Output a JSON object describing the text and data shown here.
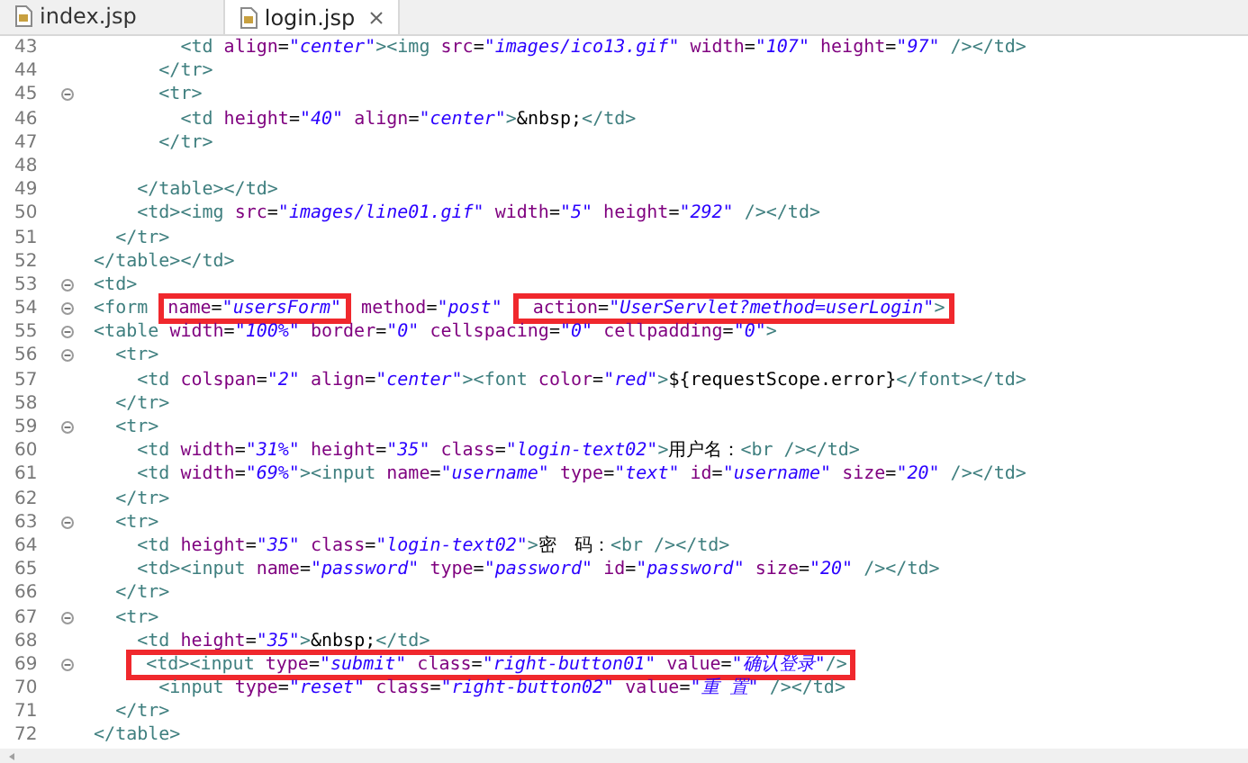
{
  "tabs": [
    {
      "label": "index.jsp",
      "selected": false,
      "closable": false
    },
    {
      "label": "login.jsp",
      "selected": true,
      "closable": true
    }
  ],
  "lines": [
    {
      "number": "43",
      "foldable": false,
      "tokens": [
        {
          "kind": "tag",
          "text": "          <td"
        },
        {
          "kind": "attr",
          "text": " align"
        },
        {
          "kind": "text",
          "text": "="
        },
        {
          "kind": "value",
          "text": "\"center\""
        },
        {
          "kind": "tag",
          "text": "><img"
        },
        {
          "kind": "attr",
          "text": " src"
        },
        {
          "kind": "text",
          "text": "="
        },
        {
          "kind": "value",
          "text": "\"images/ico13.gif\""
        },
        {
          "kind": "attr",
          "text": " width"
        },
        {
          "kind": "text",
          "text": "="
        },
        {
          "kind": "value",
          "text": "\"107\""
        },
        {
          "kind": "attr",
          "text": " height"
        },
        {
          "kind": "text",
          "text": "="
        },
        {
          "kind": "value",
          "text": "\"97\""
        },
        {
          "kind": "tag",
          "text": " /></td>"
        }
      ]
    },
    {
      "number": "44",
      "foldable": false,
      "tokens": [
        {
          "kind": "tag",
          "text": "        </tr>"
        }
      ]
    },
    {
      "number": "45",
      "foldable": true,
      "tokens": [
        {
          "kind": "tag",
          "text": "        <tr>"
        }
      ]
    },
    {
      "number": "46",
      "foldable": false,
      "tokens": [
        {
          "kind": "tag",
          "text": "          <td"
        },
        {
          "kind": "attr",
          "text": " height"
        },
        {
          "kind": "text",
          "text": "="
        },
        {
          "kind": "value",
          "text": "\"40\""
        },
        {
          "kind": "attr",
          "text": " align"
        },
        {
          "kind": "text",
          "text": "="
        },
        {
          "kind": "value",
          "text": "\"center\""
        },
        {
          "kind": "tag",
          "text": ">"
        },
        {
          "kind": "text",
          "text": "&nbsp;"
        },
        {
          "kind": "tag",
          "text": "</td>"
        }
      ]
    },
    {
      "number": "47",
      "foldable": false,
      "tokens": [
        {
          "kind": "tag",
          "text": "        </tr>"
        }
      ]
    },
    {
      "number": "48",
      "foldable": false
    },
    {
      "number": "49",
      "foldable": false,
      "tokens": [
        {
          "kind": "tag",
          "text": "      </table></td>"
        }
      ]
    },
    {
      "number": "50",
      "foldable": false,
      "tokens": [
        {
          "kind": "tag",
          "text": "      <td><img"
        },
        {
          "kind": "attr",
          "text": " src"
        },
        {
          "kind": "text",
          "text": "="
        },
        {
          "kind": "value",
          "text": "\"images/line01.gif\""
        },
        {
          "kind": "attr",
          "text": " width"
        },
        {
          "kind": "text",
          "text": "="
        },
        {
          "kind": "value",
          "text": "\"5\""
        },
        {
          "kind": "attr",
          "text": " height"
        },
        {
          "kind": "text",
          "text": "="
        },
        {
          "kind": "value",
          "text": "\"292\""
        },
        {
          "kind": "tag",
          "text": " /></td>"
        }
      ]
    },
    {
      "number": "51",
      "foldable": false,
      "tokens": [
        {
          "kind": "tag",
          "text": "    </tr>"
        }
      ]
    },
    {
      "number": "52",
      "foldable": false,
      "tokens": [
        {
          "kind": "tag",
          "text": "  </table></td>"
        }
      ]
    },
    {
      "number": "53",
      "foldable": true,
      "tokens": [
        {
          "kind": "tag",
          "text": "  <td>"
        }
      ]
    },
    {
      "number": "54",
      "foldable": true,
      "tokens": [
        {
          "kind": "tag",
          "text": "  <form "
        },
        {
          "kind": "box",
          "tokens": [
            {
              "kind": "attr",
              "text": "name"
            },
            {
              "kind": "text",
              "text": "="
            },
            {
              "kind": "value",
              "text": "\"usersForm\""
            }
          ]
        },
        {
          "kind": "attr",
          "text": " method"
        },
        {
          "kind": "text",
          "text": "="
        },
        {
          "kind": "value",
          "text": "\"post\""
        },
        {
          "kind": "box",
          "tokens": [
            {
              "kind": "attr",
              "text": "  action"
            },
            {
              "kind": "text",
              "text": "="
            },
            {
              "kind": "value",
              "text": "\"UserServlet?method=userLogin\""
            },
            {
              "kind": "tag",
              "text": ">"
            }
          ]
        }
      ]
    },
    {
      "number": "55",
      "foldable": true,
      "tokens": [
        {
          "kind": "tag",
          "text": "  <table"
        },
        {
          "kind": "attr",
          "text": " width"
        },
        {
          "kind": "text",
          "text": "="
        },
        {
          "kind": "value",
          "text": "\"100%\""
        },
        {
          "kind": "attr",
          "text": " border"
        },
        {
          "kind": "text",
          "text": "="
        },
        {
          "kind": "value",
          "text": "\"0\""
        },
        {
          "kind": "attr",
          "text": " cellspacing"
        },
        {
          "kind": "text",
          "text": "="
        },
        {
          "kind": "value",
          "text": "\"0\""
        },
        {
          "kind": "attr",
          "text": " cellpadding"
        },
        {
          "kind": "text",
          "text": "="
        },
        {
          "kind": "value",
          "text": "\"0\""
        },
        {
          "kind": "tag",
          "text": ">"
        }
      ]
    },
    {
      "number": "56",
      "foldable": true,
      "tokens": [
        {
          "kind": "tag",
          "text": "    <tr>"
        }
      ]
    },
    {
      "number": "57",
      "foldable": false,
      "tokens": [
        {
          "kind": "tag",
          "text": "      <td"
        },
        {
          "kind": "attr",
          "text": " colspan"
        },
        {
          "kind": "text",
          "text": "="
        },
        {
          "kind": "value",
          "text": "\"2\""
        },
        {
          "kind": "attr",
          "text": " align"
        },
        {
          "kind": "text",
          "text": "="
        },
        {
          "kind": "value",
          "text": "\"center\""
        },
        {
          "kind": "tag",
          "text": "><font"
        },
        {
          "kind": "attr",
          "text": " color"
        },
        {
          "kind": "text",
          "text": "="
        },
        {
          "kind": "value",
          "text": "\"red\""
        },
        {
          "kind": "tag",
          "text": ">"
        },
        {
          "kind": "text",
          "text": "${requestScope.error}"
        },
        {
          "kind": "tag",
          "text": "</font></td>"
        }
      ]
    },
    {
      "number": "58",
      "foldable": false,
      "tokens": [
        {
          "kind": "tag",
          "text": "    </tr>"
        }
      ]
    },
    {
      "number": "59",
      "foldable": true,
      "tokens": [
        {
          "kind": "tag",
          "text": "    <tr>"
        }
      ]
    },
    {
      "number": "60",
      "foldable": false,
      "tokens": [
        {
          "kind": "tag",
          "text": "      <td"
        },
        {
          "kind": "attr",
          "text": " width"
        },
        {
          "kind": "text",
          "text": "="
        },
        {
          "kind": "value",
          "text": "\"31%\""
        },
        {
          "kind": "attr",
          "text": " height"
        },
        {
          "kind": "text",
          "text": "="
        },
        {
          "kind": "value",
          "text": "\"35\""
        },
        {
          "kind": "attr",
          "text": " class"
        },
        {
          "kind": "text",
          "text": "="
        },
        {
          "kind": "value",
          "text": "\"login-text02\""
        },
        {
          "kind": "tag",
          "text": ">"
        },
        {
          "kind": "text",
          "text": "用户名："
        },
        {
          "kind": "tag",
          "text": "<br /></td>"
        }
      ]
    },
    {
      "number": "61",
      "foldable": false,
      "tokens": [
        {
          "kind": "tag",
          "text": "      <td"
        },
        {
          "kind": "attr",
          "text": " width"
        },
        {
          "kind": "text",
          "text": "="
        },
        {
          "kind": "value",
          "text": "\"69%\""
        },
        {
          "kind": "tag",
          "text": "><input"
        },
        {
          "kind": "attr",
          "text": " name"
        },
        {
          "kind": "text",
          "text": "="
        },
        {
          "kind": "value",
          "text": "\"username\""
        },
        {
          "kind": "attr",
          "text": " type"
        },
        {
          "kind": "text",
          "text": "="
        },
        {
          "kind": "value",
          "text": "\"text\""
        },
        {
          "kind": "attr",
          "text": " id"
        },
        {
          "kind": "text",
          "text": "="
        },
        {
          "kind": "value",
          "text": "\"username\""
        },
        {
          "kind": "attr",
          "text": " size"
        },
        {
          "kind": "text",
          "text": "="
        },
        {
          "kind": "value",
          "text": "\"20\""
        },
        {
          "kind": "tag",
          "text": " /></td>"
        }
      ]
    },
    {
      "number": "62",
      "foldable": false,
      "tokens": [
        {
          "kind": "tag",
          "text": "    </tr>"
        }
      ]
    },
    {
      "number": "63",
      "foldable": true,
      "tokens": [
        {
          "kind": "tag",
          "text": "    <tr>"
        }
      ]
    },
    {
      "number": "64",
      "foldable": false,
      "tokens": [
        {
          "kind": "tag",
          "text": "      <td"
        },
        {
          "kind": "attr",
          "text": " height"
        },
        {
          "kind": "text",
          "text": "="
        },
        {
          "kind": "value",
          "text": "\"35\""
        },
        {
          "kind": "attr",
          "text": " class"
        },
        {
          "kind": "text",
          "text": "="
        },
        {
          "kind": "value",
          "text": "\"login-text02\""
        },
        {
          "kind": "tag",
          "text": ">"
        },
        {
          "kind": "text",
          "text": "密　码："
        },
        {
          "kind": "tag",
          "text": "<br /></td>"
        }
      ]
    },
    {
      "number": "65",
      "foldable": false,
      "tokens": [
        {
          "kind": "tag",
          "text": "      <td><input"
        },
        {
          "kind": "attr",
          "text": " name"
        },
        {
          "kind": "text",
          "text": "="
        },
        {
          "kind": "value",
          "text": "\"password\""
        },
        {
          "kind": "attr",
          "text": " type"
        },
        {
          "kind": "text",
          "text": "="
        },
        {
          "kind": "value",
          "text": "\"password\""
        },
        {
          "kind": "attr",
          "text": " id"
        },
        {
          "kind": "text",
          "text": "="
        },
        {
          "kind": "value",
          "text": "\"password\""
        },
        {
          "kind": "attr",
          "text": " size"
        },
        {
          "kind": "text",
          "text": "="
        },
        {
          "kind": "value",
          "text": "\"20\""
        },
        {
          "kind": "tag",
          "text": " /></td>"
        }
      ]
    },
    {
      "number": "66",
      "foldable": false,
      "tokens": [
        {
          "kind": "tag",
          "text": "    </tr>"
        }
      ]
    },
    {
      "number": "67",
      "foldable": true,
      "tokens": [
        {
          "kind": "tag",
          "text": "    <tr>"
        }
      ]
    },
    {
      "number": "68",
      "foldable": false,
      "tokens": [
        {
          "kind": "tag",
          "text": "      <td"
        },
        {
          "kind": "attr",
          "text": " height"
        },
        {
          "kind": "text",
          "text": "="
        },
        {
          "kind": "value",
          "text": "\"35\""
        },
        {
          "kind": "tag",
          "text": ">"
        },
        {
          "kind": "text",
          "text": "&nbsp;"
        },
        {
          "kind": "tag",
          "text": "</td>"
        }
      ]
    },
    {
      "number": "69",
      "foldable": true,
      "tokens": [
        {
          "kind": "box",
          "tokens": [
            {
              "kind": "tag",
              "text": "      <td><input"
            },
            {
              "kind": "attr",
              "text": " type"
            },
            {
              "kind": "text",
              "text": "="
            },
            {
              "kind": "value",
              "text": "\"submit\""
            },
            {
              "kind": "attr",
              "text": " class"
            },
            {
              "kind": "text",
              "text": "="
            },
            {
              "kind": "value",
              "text": "\"right-button01\""
            },
            {
              "kind": "attr",
              "text": " value"
            },
            {
              "kind": "text",
              "text": "="
            },
            {
              "kind": "value",
              "text": "\"确认登录\""
            },
            {
              "kind": "tag",
              "text": "/>"
            }
          ]
        }
      ]
    },
    {
      "number": "70",
      "foldable": false,
      "tokens": [
        {
          "kind": "tag",
          "text": "        <input"
        },
        {
          "kind": "attr",
          "text": " type"
        },
        {
          "kind": "text",
          "text": "="
        },
        {
          "kind": "value",
          "text": "\"reset\""
        },
        {
          "kind": "attr",
          "text": " class"
        },
        {
          "kind": "text",
          "text": "="
        },
        {
          "kind": "value",
          "text": "\"right-button02\""
        },
        {
          "kind": "attr",
          "text": " value"
        },
        {
          "kind": "text",
          "text": "="
        },
        {
          "kind": "value",
          "text": "\"重 置\""
        },
        {
          "kind": "tag",
          "text": " /></td>"
        }
      ]
    },
    {
      "number": "71",
      "foldable": false,
      "tokens": [
        {
          "kind": "tag",
          "text": "    </tr>"
        }
      ]
    },
    {
      "number": "72",
      "foldable": false,
      "tokens": [
        {
          "kind": "tag",
          "text": "  </table>"
        }
      ]
    }
  ]
}
